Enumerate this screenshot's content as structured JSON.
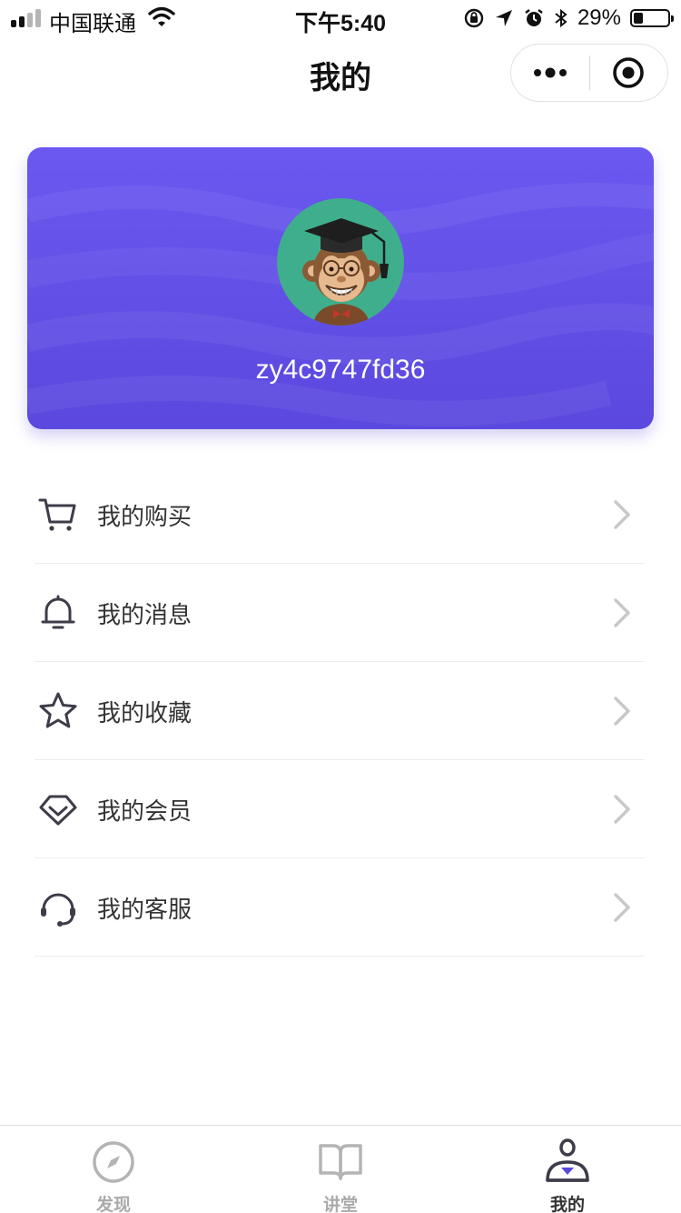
{
  "status_bar": {
    "carrier": "中国联通",
    "time": "下午5:40",
    "battery_percent": "29%",
    "battery_level": 0.29
  },
  "nav": {
    "title": "我的"
  },
  "profile": {
    "username": "zy4c9747fd36",
    "card_color": "#6a58f0",
    "avatar_bg": "#3fae8c"
  },
  "menu": {
    "items": [
      {
        "label": "我的购买",
        "icon": "cart-icon"
      },
      {
        "label": "我的消息",
        "icon": "bell-icon"
      },
      {
        "label": "我的收藏",
        "icon": "star-icon"
      },
      {
        "label": "我的会员",
        "icon": "diamond-icon"
      },
      {
        "label": "我的客服",
        "icon": "headset-icon"
      }
    ]
  },
  "tabs": [
    {
      "label": "发现",
      "icon": "compass-icon",
      "active": false
    },
    {
      "label": "讲堂",
      "icon": "book-icon",
      "active": false
    },
    {
      "label": "我的",
      "icon": "user-icon",
      "active": true
    }
  ],
  "colors": {
    "accent": "#5b48de",
    "tab_active": "#333333",
    "tab_inactive": "#aaaaaa"
  }
}
